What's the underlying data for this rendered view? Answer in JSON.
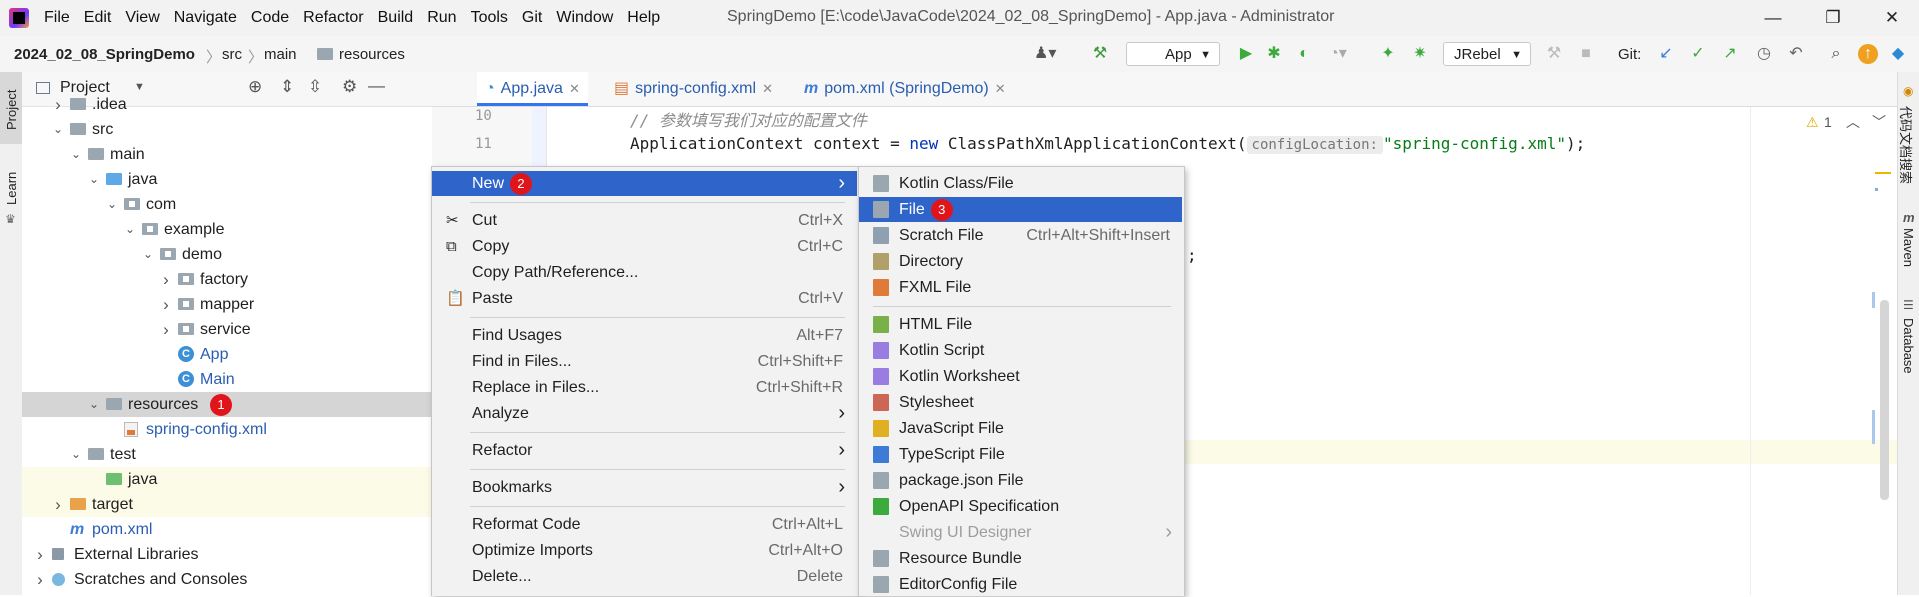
{
  "app": {
    "menus": [
      "File",
      "Edit",
      "View",
      "Navigate",
      "Code",
      "Refactor",
      "Build",
      "Run",
      "Tools",
      "Git",
      "Window",
      "Help"
    ],
    "window_title": "SpringDemo [E:\\code\\JavaCode\\2024_02_08_SpringDemo] - App.java - Administrator"
  },
  "breadcrumb": [
    "2024_02_08_SpringDemo",
    "src",
    "main",
    "resources"
  ],
  "toolbar": {
    "run_config": "App",
    "jrebel": "JRebel",
    "git_label": "Git:"
  },
  "left_stripe": {
    "project": "Project",
    "learn": "Learn"
  },
  "project_panel": {
    "title": "Project",
    "tree": [
      {
        "label": ".idea",
        "indent": 1,
        "arrow": "›",
        "icon": "folder-grey"
      },
      {
        "label": "src",
        "indent": 1,
        "arrow": "⌄",
        "icon": "folder-grey"
      },
      {
        "label": "main",
        "indent": 2,
        "arrow": "⌄",
        "icon": "folder-grey"
      },
      {
        "label": "java",
        "indent": 3,
        "arrow": "⌄",
        "icon": "folder-blue"
      },
      {
        "label": "com",
        "indent": 4,
        "arrow": "⌄",
        "icon": "package"
      },
      {
        "label": "example",
        "indent": 5,
        "arrow": "⌄",
        "icon": "package"
      },
      {
        "label": "demo",
        "indent": 6,
        "arrow": "⌄",
        "icon": "package"
      },
      {
        "label": "factory",
        "indent": 7,
        "arrow": "›",
        "icon": "package"
      },
      {
        "label": "mapper",
        "indent": 7,
        "arrow": "›",
        "icon": "package"
      },
      {
        "label": "service",
        "indent": 7,
        "arrow": "›",
        "icon": "package"
      },
      {
        "label": "App",
        "indent": 7,
        "arrow": "",
        "icon": "class"
      },
      {
        "label": "Main",
        "indent": 7,
        "arrow": "",
        "icon": "class"
      },
      {
        "label": "resources",
        "indent": 3,
        "arrow": "⌄",
        "icon": "folder-res",
        "selected": true,
        "badge": "1"
      },
      {
        "label": "spring-config.xml",
        "indent": 4,
        "arrow": "",
        "icon": "xml"
      },
      {
        "label": "test",
        "indent": 2,
        "arrow": "⌄",
        "icon": "folder-grey"
      },
      {
        "label": "java",
        "indent": 3,
        "arrow": "",
        "icon": "folder-green",
        "highlight": true
      },
      {
        "label": "target",
        "indent": 1,
        "arrow": "›",
        "icon": "folder-orange",
        "highlight": true
      },
      {
        "label": "pom.xml",
        "indent": 1,
        "arrow": "",
        "icon": "maven"
      },
      {
        "label": "External Libraries",
        "indent": 0,
        "arrow": "›",
        "icon": "library"
      },
      {
        "label": "Scratches and Consoles",
        "indent": 0,
        "arrow": "›",
        "icon": "scratch"
      }
    ]
  },
  "editor": {
    "tabs": [
      {
        "label": "App.java",
        "active": true
      },
      {
        "label": "spring-config.xml"
      },
      {
        "label": "pom.xml (SpringDemo)"
      }
    ],
    "lines": [
      {
        "no": "10",
        "text": "// 参数填写我们对应的配置文件"
      },
      {
        "no": "11",
        "pre": "ApplicationContext context = ",
        "kw": "new",
        "mid": " ClassPathXmlApplicationContext(",
        "hint": "configLocation:",
        "str": "\"spring-config.xml\"",
        "post": ");"
      }
    ],
    "partial_char": ";",
    "warnings": "1"
  },
  "right_stripe": {
    "items": [
      "代码文档搜索",
      "Maven",
      "Database"
    ]
  },
  "context_menu": {
    "items": [
      {
        "label": "New",
        "submenu": true,
        "selected": true,
        "badge": "2"
      },
      {
        "sep": true
      },
      {
        "label": "Cut",
        "shortcut": "Ctrl+X",
        "icon": "cut"
      },
      {
        "label": "Copy",
        "shortcut": "Ctrl+C",
        "icon": "copy"
      },
      {
        "label": "Copy Path/Reference..."
      },
      {
        "label": "Paste",
        "shortcut": "Ctrl+V",
        "icon": "paste"
      },
      {
        "sep": true
      },
      {
        "label": "Find Usages",
        "shortcut": "Alt+F7"
      },
      {
        "label": "Find in Files...",
        "shortcut": "Ctrl+Shift+F"
      },
      {
        "label": "Replace in Files...",
        "shortcut": "Ctrl+Shift+R"
      },
      {
        "label": "Analyze",
        "submenu": true
      },
      {
        "sep": true
      },
      {
        "label": "Refactor",
        "submenu": true
      },
      {
        "sep": true
      },
      {
        "label": "Bookmarks",
        "submenu": true
      },
      {
        "sep": true
      },
      {
        "label": "Reformat Code",
        "shortcut": "Ctrl+Alt+L"
      },
      {
        "label": "Optimize Imports",
        "shortcut": "Ctrl+Alt+O"
      },
      {
        "label": "Delete...",
        "shortcut": "Delete"
      }
    ]
  },
  "new_submenu": {
    "items": [
      {
        "label": "Kotlin Class/File"
      },
      {
        "label": "File",
        "selected": true,
        "badge": "3"
      },
      {
        "label": "Scratch File",
        "shortcut": "Ctrl+Alt+Shift+Insert"
      },
      {
        "label": "Directory"
      },
      {
        "label": "FXML File"
      },
      {
        "sep": true
      },
      {
        "label": "HTML File"
      },
      {
        "label": "Kotlin Script"
      },
      {
        "label": "Kotlin Worksheet"
      },
      {
        "label": "Stylesheet"
      },
      {
        "label": "JavaScript File"
      },
      {
        "label": "TypeScript File"
      },
      {
        "label": "package.json File"
      },
      {
        "label": "OpenAPI Specification"
      },
      {
        "label": "Swing UI Designer",
        "disabled": true,
        "submenu": true
      },
      {
        "label": "Resource Bundle"
      },
      {
        "label": "EditorConfig File"
      }
    ]
  },
  "colors": {
    "selection": "#2f65ca",
    "badge": "#e0151b",
    "tree_selected": "#d5d5d5",
    "highlight_row": "#fbfbe7"
  }
}
